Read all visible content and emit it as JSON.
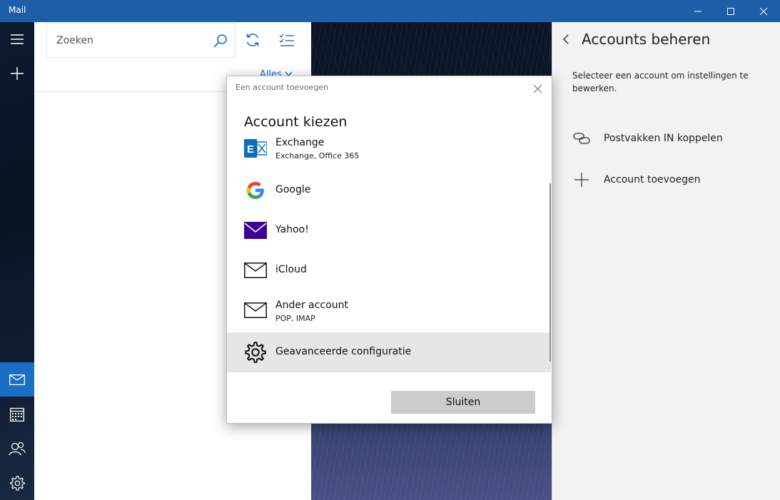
{
  "window": {
    "title": "Mail"
  },
  "search": {
    "placeholder": "Zoeken"
  },
  "list": {
    "filter_label": "Alles"
  },
  "settings": {
    "title": "Accounts beheren",
    "description": "Selecteer een account om instellingen te bewerken.",
    "items": [
      {
        "label": "Postvakken IN koppelen",
        "icon": "link-icon"
      },
      {
        "label": "Account toevoegen",
        "icon": "plus-icon"
      }
    ]
  },
  "dialog": {
    "title": "Een account toevoegen",
    "heading": "Account kiezen",
    "accounts": [
      {
        "name": "Exchange",
        "sub": "Exchange, Office 365",
        "icon": "exchange-icon"
      },
      {
        "name": "Google",
        "sub": "",
        "icon": "google-icon"
      },
      {
        "name": "Yahoo!",
        "sub": "",
        "icon": "yahoo-mail-icon"
      },
      {
        "name": "iCloud",
        "sub": "",
        "icon": "envelope-icon"
      },
      {
        "name": "Ander account",
        "sub": "POP, IMAP",
        "icon": "envelope-icon"
      },
      {
        "name": "Geavanceerde configuratie",
        "sub": "",
        "icon": "gear-icon"
      }
    ],
    "close_label": "Sluiten"
  },
  "colors": {
    "titlebar": "#1e5ea8",
    "accent": "#1a6fc4",
    "yahoo": "#410093"
  }
}
